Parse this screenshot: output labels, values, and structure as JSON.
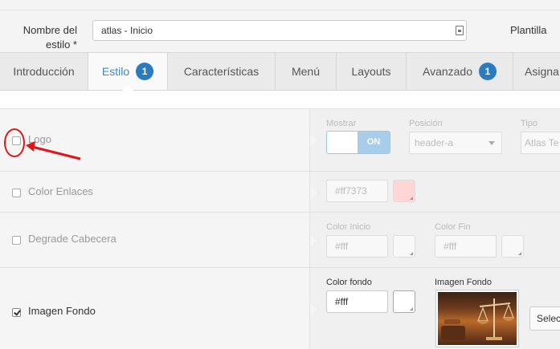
{
  "header": {
    "name_label_line1": "Nombre del",
    "name_label_line2": "estilo *",
    "name_value": "atlas - Inicio",
    "plantilla_label": "Plantilla"
  },
  "tabs": [
    {
      "label": "Introducción"
    },
    {
      "label": "Estilo",
      "badge": "1",
      "active": true
    },
    {
      "label": "Características"
    },
    {
      "label": "Menú"
    },
    {
      "label": "Layouts"
    },
    {
      "label": "Avanzado",
      "badge": "1"
    },
    {
      "label": "Asigna"
    }
  ],
  "rows": {
    "logo": {
      "label": "Logo",
      "checked": false,
      "mostrar_label": "Mostrar",
      "toggle_on": "ON",
      "posicion_label": "Posición",
      "posicion_value": "header-a",
      "tipo_label": "Tipo",
      "tipo_value": "Atlas Te"
    },
    "color_enlaces": {
      "label": "Color Enlaces",
      "checked": false,
      "value": "#ff7373",
      "swatch_color": "#ffd6d6"
    },
    "degrade_cabecera": {
      "label": "Degrade Cabecera",
      "checked": false,
      "inicio_label": "Color Inicio",
      "inicio_value": "#fff",
      "fin_label": "Color Fin",
      "fin_value": "#fff"
    },
    "imagen_fondo": {
      "label": "Imagen Fondo",
      "checked": true,
      "color_fondo_label": "Color fondo",
      "color_fondo_value": "#fff",
      "imagen_label": "Imagen Fondo",
      "select_button": "Selec"
    }
  },
  "colors": {
    "accent": "#3b8bc9",
    "badge": "#2a7bbf",
    "annotation": "#e0161b"
  }
}
